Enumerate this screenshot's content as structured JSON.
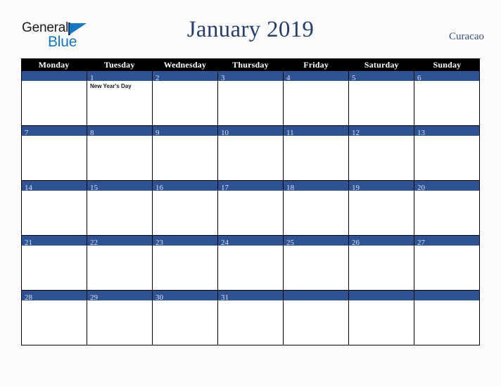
{
  "brand": {
    "name_line1": "General",
    "name_line2": "Blue",
    "triangle_color": "#1277c4",
    "text_color": "#1b1b1b"
  },
  "header": {
    "title": "January 2019",
    "locale": "Curacao",
    "title_color": "#27406b",
    "locale_color": "#3b5480"
  },
  "calendar": {
    "month": "January",
    "year": "2019",
    "day_headers": [
      "Monday",
      "Tuesday",
      "Wednesday",
      "Thursday",
      "Friday",
      "Saturday",
      "Sunday"
    ],
    "header_bg": "#000000",
    "header_text": "#ffffff",
    "daybar_bg": "#2e5395",
    "daynum_text": "#d9e1f0",
    "weeks": [
      [
        {
          "day": "",
          "events": []
        },
        {
          "day": "1",
          "events": [
            "New Year's Day"
          ]
        },
        {
          "day": "2",
          "events": []
        },
        {
          "day": "3",
          "events": []
        },
        {
          "day": "4",
          "events": []
        },
        {
          "day": "5",
          "events": []
        },
        {
          "day": "6",
          "events": []
        }
      ],
      [
        {
          "day": "7",
          "events": []
        },
        {
          "day": "8",
          "events": []
        },
        {
          "day": "9",
          "events": []
        },
        {
          "day": "10",
          "events": []
        },
        {
          "day": "11",
          "events": []
        },
        {
          "day": "12",
          "events": []
        },
        {
          "day": "13",
          "events": []
        }
      ],
      [
        {
          "day": "14",
          "events": []
        },
        {
          "day": "15",
          "events": []
        },
        {
          "day": "16",
          "events": []
        },
        {
          "day": "17",
          "events": []
        },
        {
          "day": "18",
          "events": []
        },
        {
          "day": "19",
          "events": []
        },
        {
          "day": "20",
          "events": []
        }
      ],
      [
        {
          "day": "21",
          "events": []
        },
        {
          "day": "22",
          "events": []
        },
        {
          "day": "23",
          "events": []
        },
        {
          "day": "24",
          "events": []
        },
        {
          "day": "25",
          "events": []
        },
        {
          "day": "26",
          "events": []
        },
        {
          "day": "27",
          "events": []
        }
      ],
      [
        {
          "day": "28",
          "events": []
        },
        {
          "day": "29",
          "events": []
        },
        {
          "day": "30",
          "events": []
        },
        {
          "day": "31",
          "events": []
        },
        {
          "day": "",
          "events": []
        },
        {
          "day": "",
          "events": []
        },
        {
          "day": "",
          "events": []
        }
      ]
    ]
  }
}
